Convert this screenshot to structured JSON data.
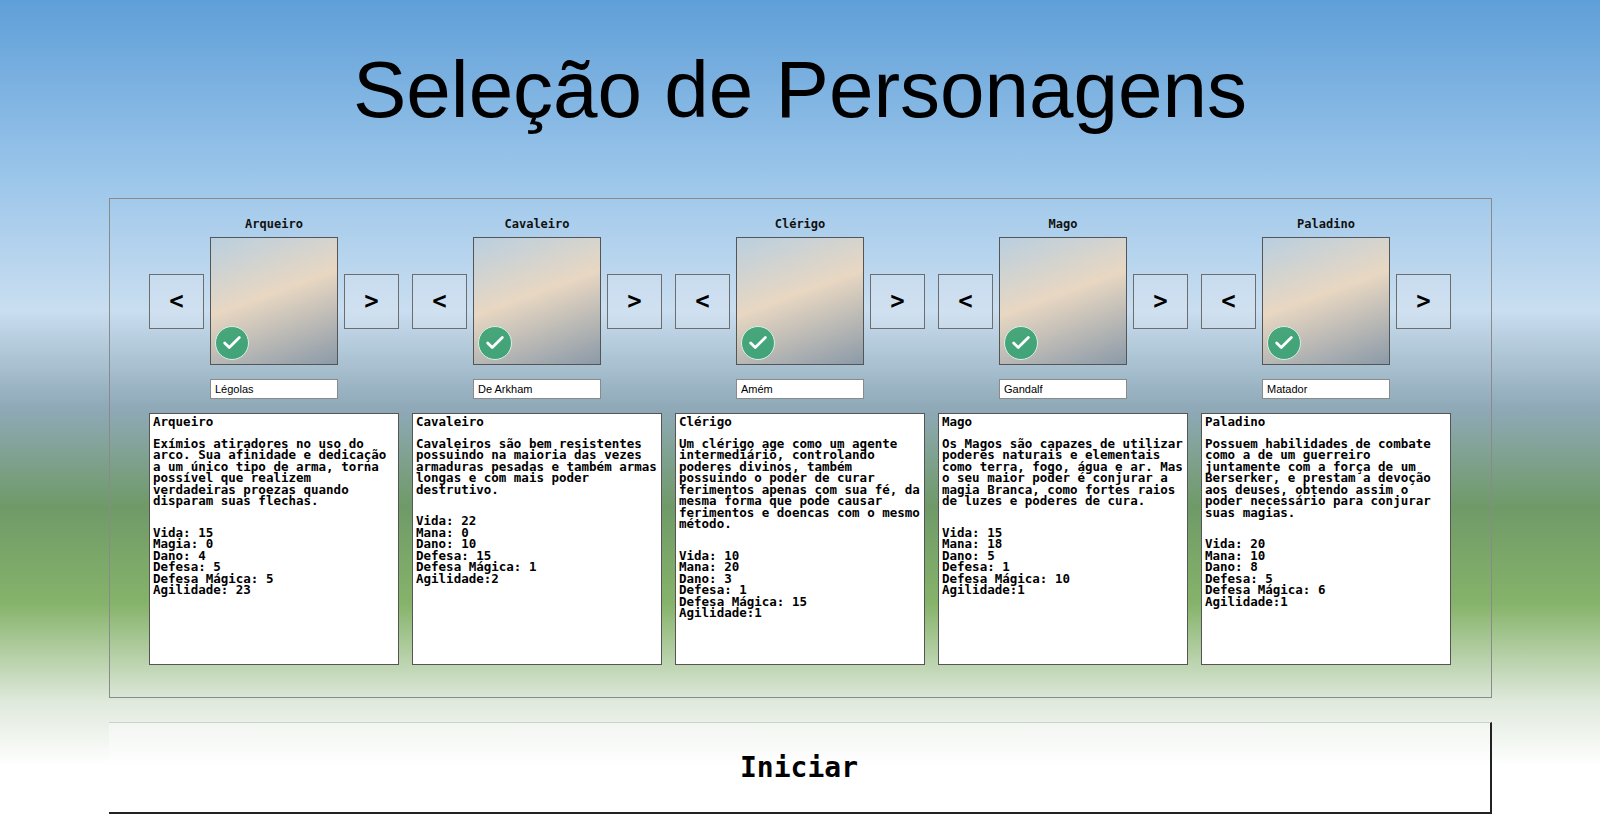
{
  "window": {
    "title": "Seleção de Personagens"
  },
  "characters": [
    {
      "label": "Arqueiro",
      "name": "Légolas",
      "checked": true,
      "prev": "<",
      "next": ">",
      "title": "Arqueiro",
      "description": "Exímios atiradores no uso do arco. Sua afinidade e dedicação a um único tipo de arma, torna possível que realizem verdadeiras proezas quando disparam suas flechas.",
      "stats": [
        "Vida: 15",
        "Magia: 0",
        "Dano: 4",
        "Defesa: 5",
        "Defesa Mágica: 5",
        "Agilidade: 23"
      ]
    },
    {
      "label": "Cavaleiro",
      "name": "De Arkham",
      "checked": true,
      "prev": "<",
      "next": ">",
      "title": "Cavaleiro",
      "description": "Cavaleiros são bem resistentes possuindo na maioria das vezes armaduras pesadas e também armas longas e com mais poder destrutivo.",
      "stats": [
        "Vida: 22",
        "Mana: 0",
        "Dano: 10",
        "Defesa: 15",
        "Defesa Mágica: 1",
        "Agilidade:2"
      ]
    },
    {
      "label": "Clérigo",
      "name": "Amém",
      "checked": true,
      "prev": "<",
      "next": ">",
      "title": "Clérigo",
      "description": "Um clérigo age como um agente intermediário, controlando poderes divinos, também possuindo o poder de curar ferimentos apenas com sua fé, da mesma forma que pode causar ferimentos e doencas com o mesmo método.",
      "stats": [
        "Vida: 10",
        "Mana: 20",
        "Dano: 3",
        "Defesa: 1",
        "Defesa Mágica: 15",
        "Agilidade:1"
      ]
    },
    {
      "label": "Mago",
      "name": "Gandalf",
      "checked": true,
      "prev": "<",
      "next": ">",
      "title": "Mago",
      "description": "Os Magos são capazes de utilizar poderes naturais e elementais como terra, fogo, água e ar. Mas o seu maior poder é conjurar a magia Branca, como fortes raios de luzes e poderes de cura.",
      "stats": [
        "Vida: 15",
        "Mana: 18",
        "Dano: 5",
        "Defesa: 1",
        "Defesa Mágica: 10",
        "Agilidade:1"
      ]
    },
    {
      "label": "Paladino",
      "name": "Matador",
      "checked": true,
      "prev": "<",
      "next": ">",
      "title": "Paladino",
      "description": "Possuem habilidades de combate como a de um guerreiro juntamente com a força de um Berserker, e prestam a devoção aos deuses, obtendo assim o poder necessário para conjurar suas magias.",
      "stats": [
        "Vida: 20",
        "Mana: 10",
        "Dano: 8",
        "Defesa: 5",
        "Defesa Mágica: 6",
        "Agilidade:1"
      ]
    }
  ],
  "start_button": "Iniciar"
}
